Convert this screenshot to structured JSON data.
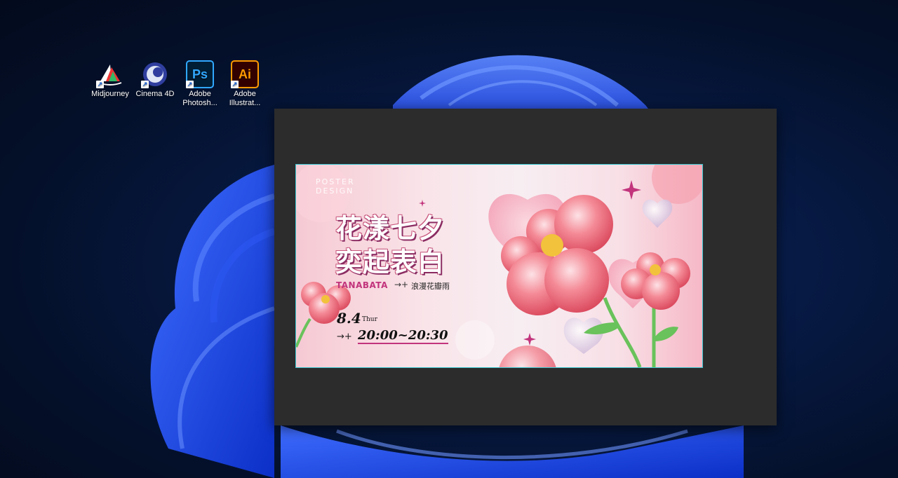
{
  "desktop": {
    "icons": [
      {
        "label": "Midjourney",
        "icon": "sailboat-icon"
      },
      {
        "label": "Cinema 4D",
        "icon": "cinema4d-icon"
      },
      {
        "label": "Adobe Photosh...",
        "icon": "photoshop-icon",
        "glyph": "Ps",
        "color": "#31a8ff",
        "bg": "#001e36"
      },
      {
        "label": "Adobe Illustrat...",
        "icon": "illustrator-icon",
        "glyph": "Ai",
        "color": "#ff9a00",
        "bg": "#330000"
      }
    ]
  },
  "poster": {
    "label_line1": "POSTER",
    "label_line2": "DESIGN",
    "headline_1": "花漾七夕",
    "headline_2": "奕起表白",
    "tanabata": "TANABATA",
    "arrow": "→+",
    "subtitle": "浪漫花瓣雨",
    "date": "8.4",
    "day": "Thur",
    "time_arrow": "→+",
    "time": "20:00~20:30"
  },
  "colors": {
    "accent_pink": "#c2347c",
    "selection_outline": "#38c7d0",
    "app_bg": "#2c2c2c"
  }
}
